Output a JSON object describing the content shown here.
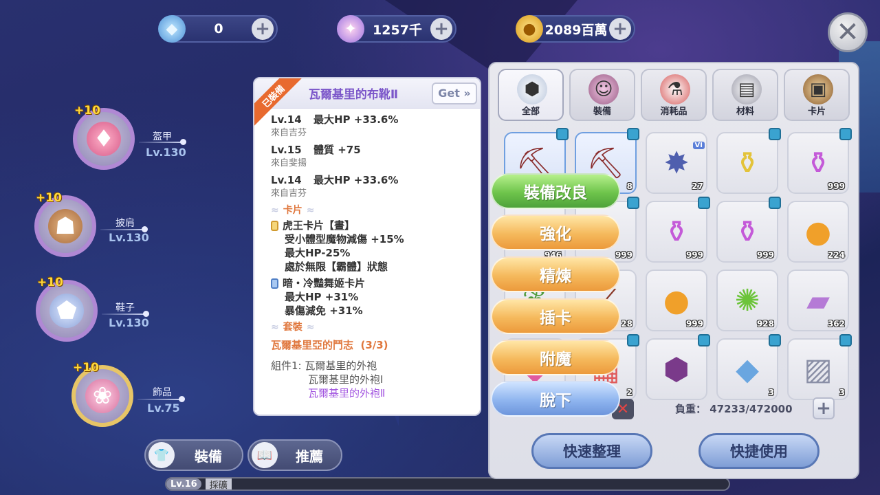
{
  "currencies": {
    "diamond": {
      "value": "0",
      "icon": "diamond-icon"
    },
    "crystal": {
      "value": "1257千",
      "icon": "crystal-icon"
    },
    "zeny": {
      "value": "2089百萬",
      "icon": "zeny-coin-icon"
    },
    "plus": "+"
  },
  "close": "✕",
  "slots": [
    {
      "label": "盔甲",
      "lv": "Lv.130",
      "refine": "+10"
    },
    {
      "label": "披肩",
      "lv": "Lv.130",
      "refine": "+10"
    },
    {
      "label": "鞋子",
      "lv": "Lv.130",
      "refine": "+10"
    },
    {
      "label": "飾品",
      "lv": "Lv.75",
      "refine": "+10"
    }
  ],
  "bottom_tabs": {
    "equip": "裝備",
    "recommend": "推薦"
  },
  "exp_bar": {
    "level": "Lv.16",
    "job": "採礦"
  },
  "tooltip": {
    "ribbon": "已裝備",
    "title": "瓦爾基里的布靴Ⅱ",
    "get": "Get »",
    "attrs": [
      {
        "lv": "Lv.14",
        "stat": "最大HP +33.6%",
        "src": "來自吉芬"
      },
      {
        "lv": "Lv.15",
        "stat": "體質 +75",
        "src": "來自斐揚"
      },
      {
        "lv": "Lv.14",
        "stat": "最大HP +33.6%",
        "src": "來自吉芬"
      }
    ],
    "card_section": "卡片",
    "cards": [
      {
        "name": "虎王卡片【晝】",
        "lines": [
          "受小體型魔物減傷 +15%",
          "最大HP-25%",
          "處於無限【霸體】狀態"
        ]
      },
      {
        "name": "暗・冷豔舞姬卡片",
        "lines": [
          "最大HP +31%",
          "暴傷減免 +31%"
        ]
      }
    ],
    "set_section": "套裝",
    "set_name": "瓦爾基里亞的鬥志",
    "set_count": "(3/3)",
    "set_components_label": "組件1:",
    "set_components": [
      "瓦爾基里的外袍",
      "瓦爾基里的外袍Ⅰ",
      "瓦爾基里的外袍Ⅱ"
    ]
  },
  "inventory": {
    "tabs": [
      {
        "label": "全部",
        "icon": "all-items-icon"
      },
      {
        "label": "裝備",
        "icon": "equipment-icon"
      },
      {
        "label": "消耗品",
        "icon": "consumable-icon"
      },
      {
        "label": "材料",
        "icon": "material-icon"
      },
      {
        "label": "卡片",
        "icon": "card-icon"
      }
    ],
    "items": [
      {
        "qty": "",
        "icon": "pickaxe-icon"
      },
      {
        "qty": "8",
        "icon": "pickaxe-icon"
      },
      {
        "qty": "27",
        "icon": "ore-icon",
        "tag": "VI"
      },
      {
        "qty": "",
        "icon": "yellow-potion-icon"
      },
      {
        "qty": "999",
        "icon": "purple-potion-icon"
      },
      {
        "qty": "946",
        "icon": "potion-icon"
      },
      {
        "qty": "999",
        "icon": "potion-icon"
      },
      {
        "qty": "999",
        "icon": "purple-potion-icon"
      },
      {
        "qty": "999",
        "icon": "purple-potion-icon"
      },
      {
        "qty": "224",
        "icon": "orange-orb-icon"
      },
      {
        "qty": "",
        "icon": "leaf-icon"
      },
      {
        "qty": "28",
        "icon": "stick-icon"
      },
      {
        "qty": "999",
        "icon": "orange-orb-icon"
      },
      {
        "qty": "928",
        "icon": "lime-icon"
      },
      {
        "qty": "362",
        "icon": "purple-ingot-icon"
      },
      {
        "qty": "",
        "icon": "gem-icon"
      },
      {
        "qty": "2",
        "icon": "box-icon"
      },
      {
        "qty": "",
        "icon": "dark-gem-icon"
      },
      {
        "qty": "3",
        "icon": "blue-crystal-icon"
      },
      {
        "qty": "3",
        "icon": "stone-tablet-icon"
      }
    ],
    "weight_label": "負重：",
    "weight_value": "47233/472000",
    "plus": "+",
    "remove": "✕",
    "sort_button": "快速整理",
    "quick_use_button": "快捷使用"
  },
  "actions": [
    "裝備改良",
    "強化",
    "精煉",
    "插卡",
    "附魔",
    "脫下"
  ]
}
